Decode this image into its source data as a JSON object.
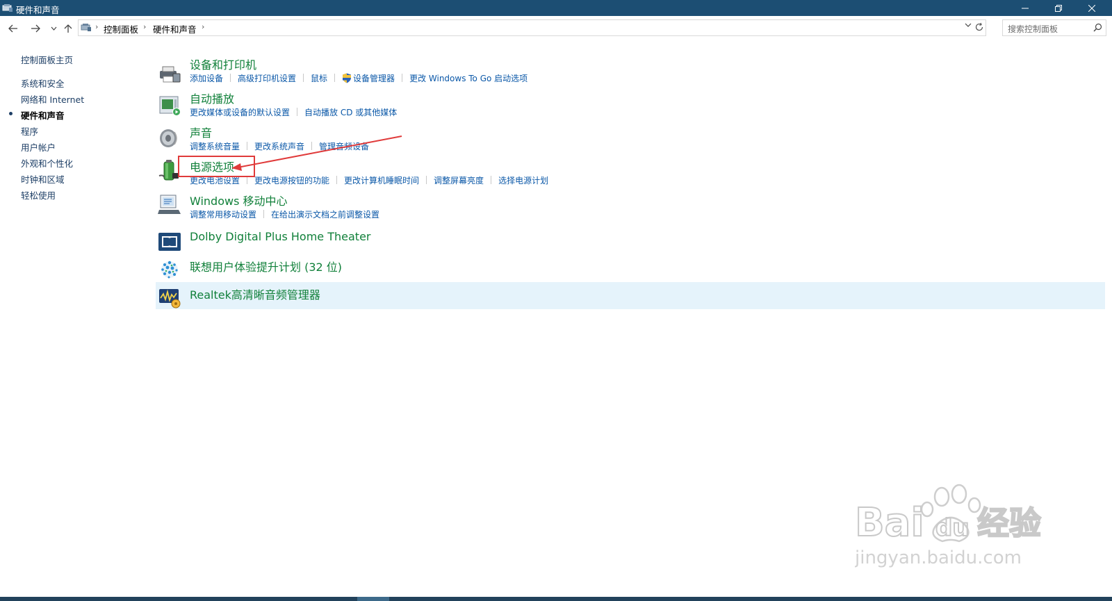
{
  "window": {
    "title": "硬件和声音"
  },
  "address": {
    "breadcrumbs": [
      "控制面板",
      "硬件和声音"
    ],
    "search_placeholder": "搜索控制面板"
  },
  "leftnav": {
    "items": [
      {
        "label": "控制面板主页",
        "active": false
      },
      {
        "label": "系统和安全",
        "active": false
      },
      {
        "label": "网络和 Internet",
        "active": false
      },
      {
        "label": "硬件和声音",
        "active": true
      },
      {
        "label": "程序",
        "active": false
      },
      {
        "label": "用户帐户",
        "active": false
      },
      {
        "label": "外观和个性化",
        "active": false
      },
      {
        "label": "时钟和区域",
        "active": false
      },
      {
        "label": "轻松使用",
        "active": false
      }
    ]
  },
  "categories": [
    {
      "title": "设备和打印机",
      "icon": "printer-icon",
      "links": [
        "添加设备",
        "高级打印机设置",
        "鼠标",
        "设备管理器",
        "更改 Windows To Go 启动选项"
      ]
    },
    {
      "title": "自动播放",
      "icon": "autoplay-icon",
      "links": [
        "更改媒体或设备的默认设置",
        "自动播放 CD 或其他媒体"
      ]
    },
    {
      "title": "声音",
      "icon": "speaker-icon",
      "links": [
        "调整系统音量",
        "更改系统声音",
        "管理音频设备"
      ]
    },
    {
      "title": "电源选项",
      "icon": "battery-icon",
      "links": [
        "更改电池设置",
        "更改电源按钮的功能",
        "更改计算机睡眠时间",
        "调整屏幕亮度",
        "选择电源计划"
      ]
    },
    {
      "title": "Windows 移动中心",
      "icon": "mobility-center-icon",
      "links": [
        "调整常用移动设置",
        "在给出演示文档之前调整设置"
      ]
    },
    {
      "title": "Dolby Digital Plus Home Theater",
      "icon": "dolby-icon",
      "links": []
    },
    {
      "title": "联想用户体验提升计划 (32 位)",
      "icon": "lenovo-globe-icon",
      "links": []
    },
    {
      "title": "Realtek高清晰音频管理器",
      "icon": "realtek-audio-icon",
      "links": []
    }
  ],
  "colors": {
    "titlebar": "#1c4e73",
    "category_title": "#11803a",
    "link": "#0b58a8",
    "highlight": "#e5f3fb",
    "annotation": "#e03a3a"
  },
  "watermark": {
    "brand": "Bai",
    "brand2": "du",
    "cn": "经验",
    "url": "jingyan.baidu.com"
  }
}
